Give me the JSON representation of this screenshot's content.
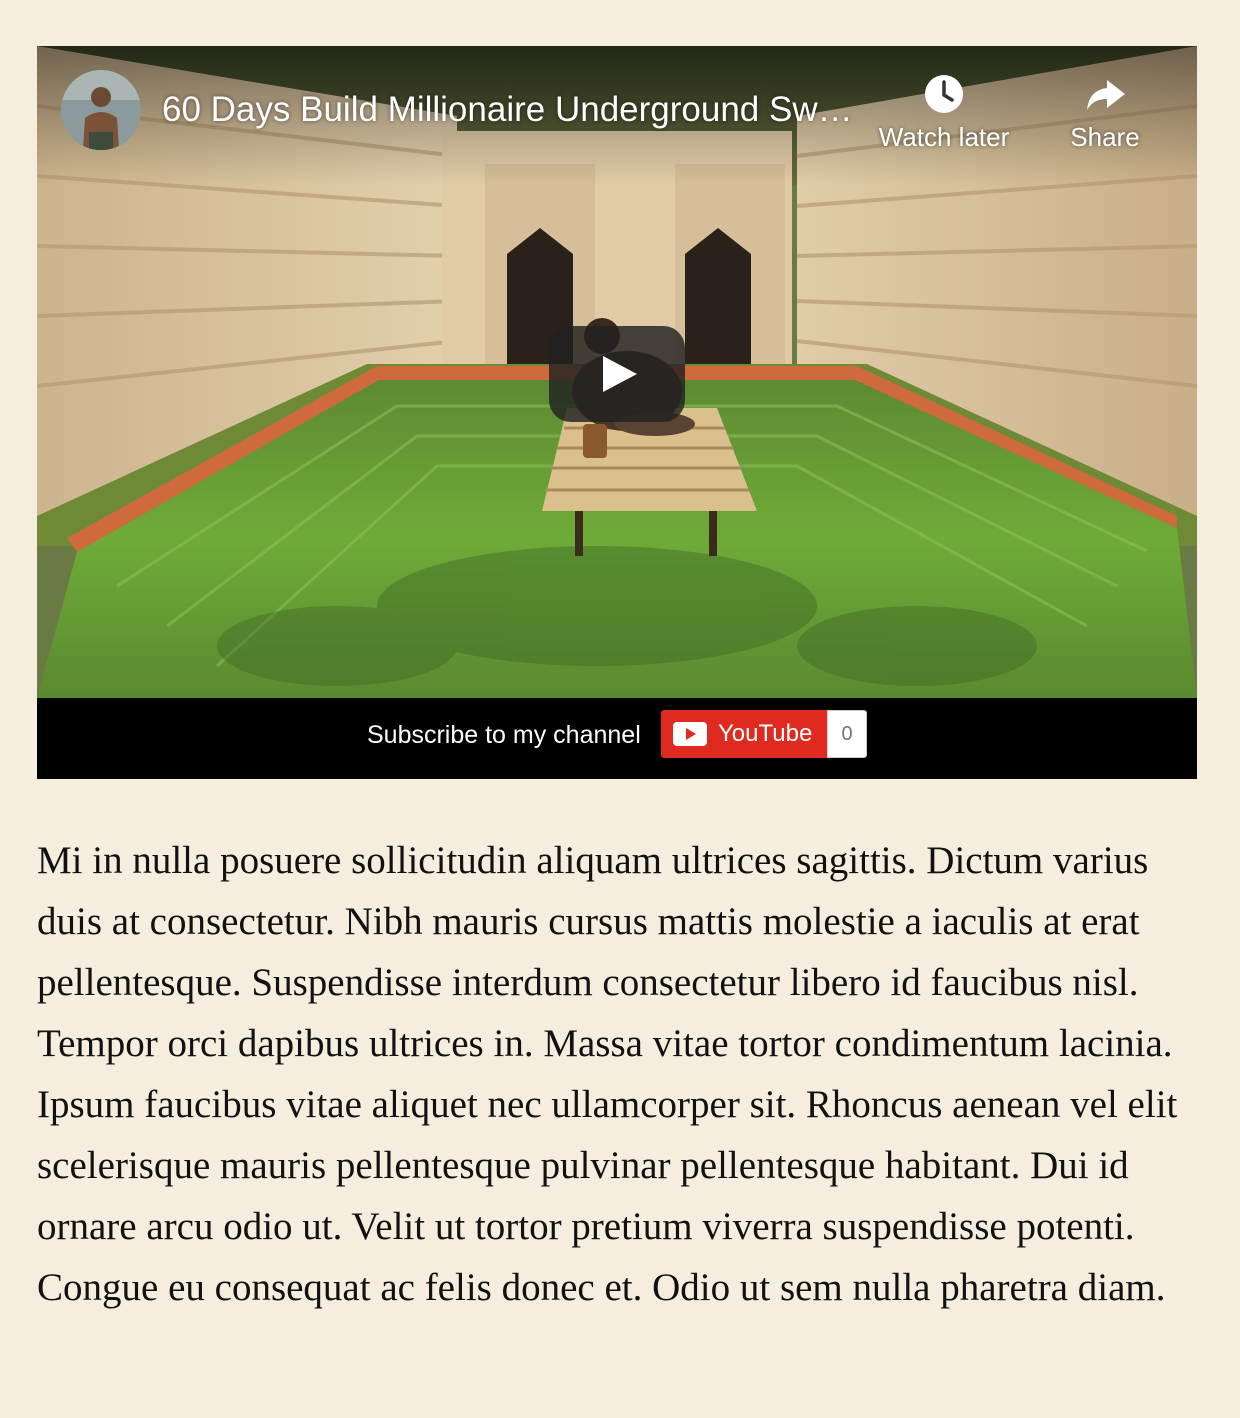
{
  "video": {
    "title": "60 Days Build Millionaire Underground Sw…",
    "watch_later_label": "Watch later",
    "share_label": "Share",
    "play_icon": "play-icon",
    "avatar_icon": "channel-avatar"
  },
  "subscribe": {
    "text": "Subscribe to my channel",
    "button_label": "YouTube",
    "count": "0",
    "brand_color": "#e02a20"
  },
  "article": {
    "paragraph": "Mi in nulla posuere sollicitudin aliquam ultrices sagittis. Dictum varius duis at consectetur. Nibh mauris cursus mattis molestie a iaculis at erat pellentesque. Suspendisse interdum consectetur libero id faucibus nisl. Tempor orci dapibus ultrices in. Massa vitae tortor condimentum lacinia. Ipsum faucibus vitae aliquet nec ullamcorper sit. Rhoncus aenean vel elit scelerisque mauris pellentesque pulvinar pellentesque habitant. Dui id ornare arcu odio ut. Velit ut tortor pretium viverra suspendisse potenti. Congue eu consequat ac felis donec et. Odio ut sem nulla pharetra diam."
  },
  "colors": {
    "page_background": "#f5eedf",
    "text": "#111111"
  }
}
